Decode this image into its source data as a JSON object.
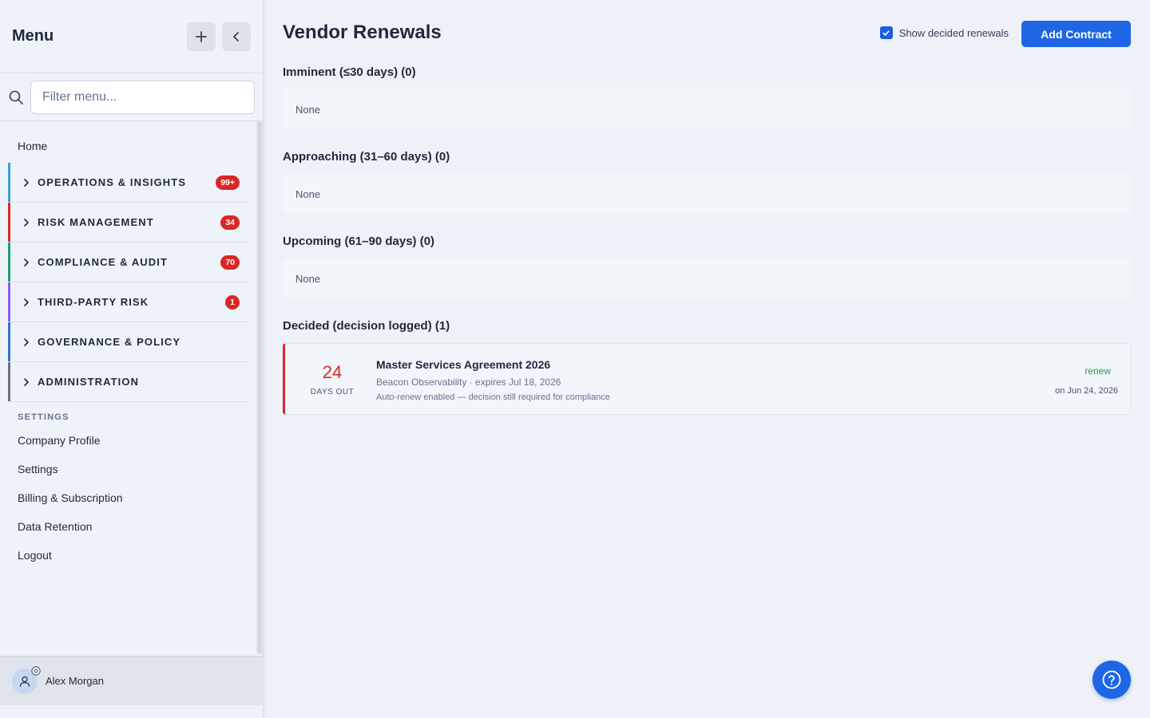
{
  "sidebar": {
    "title": "Menu",
    "search_placeholder": "Filter menu...",
    "home": "Home",
    "groups": [
      {
        "label": "OPERATIONS & INSIGHTS",
        "badge": "99+",
        "color": "#3b9fd8"
      },
      {
        "label": "RISK MANAGEMENT",
        "badge": "34",
        "color": "#dc2626"
      },
      {
        "label": "COMPLIANCE & AUDIT",
        "badge": "70",
        "color": "#1f9d73"
      },
      {
        "label": "THIRD-PARTY RISK",
        "badge": "1",
        "color": "#8b5cf6"
      },
      {
        "label": "GOVERNANCE & POLICY",
        "badge": "",
        "color": "#3b6fd8"
      },
      {
        "label": "ADMINISTRATION",
        "badge": "",
        "color": "#6b7280"
      }
    ],
    "settings_label": "SETTINGS",
    "settings_items": [
      "Company Profile",
      "Settings",
      "Billing & Subscription",
      "Data Retention",
      "Logout"
    ],
    "user": {
      "name": "Alex Morgan"
    }
  },
  "main": {
    "title": "Vendor Renewals",
    "show_decided_label": "Show decided renewals",
    "show_decided_checked": true,
    "add_button": "Add Contract",
    "sections": [
      {
        "heading": "Imminent (≤30 days) (0)",
        "empty": "None"
      },
      {
        "heading": "Approaching (31–60 days) (0)",
        "empty": "None"
      },
      {
        "heading": "Upcoming (61–90 days) (0)",
        "empty": "None"
      },
      {
        "heading": "Decided (decision logged) (1)"
      }
    ],
    "decided_card": {
      "days": "24",
      "days_label": "DAYS OUT",
      "title": "Master Services Agreement 2026",
      "subtitle": "Beacon Observability · expires Jul 18, 2026",
      "note": "Auto-renew enabled — decision still required for compliance",
      "decision": "renew",
      "decision_date": "on Jun 24, 2026"
    }
  },
  "colors": {
    "accent": "#1f66e5",
    "danger": "#dc2626",
    "success": "#16a34a"
  }
}
